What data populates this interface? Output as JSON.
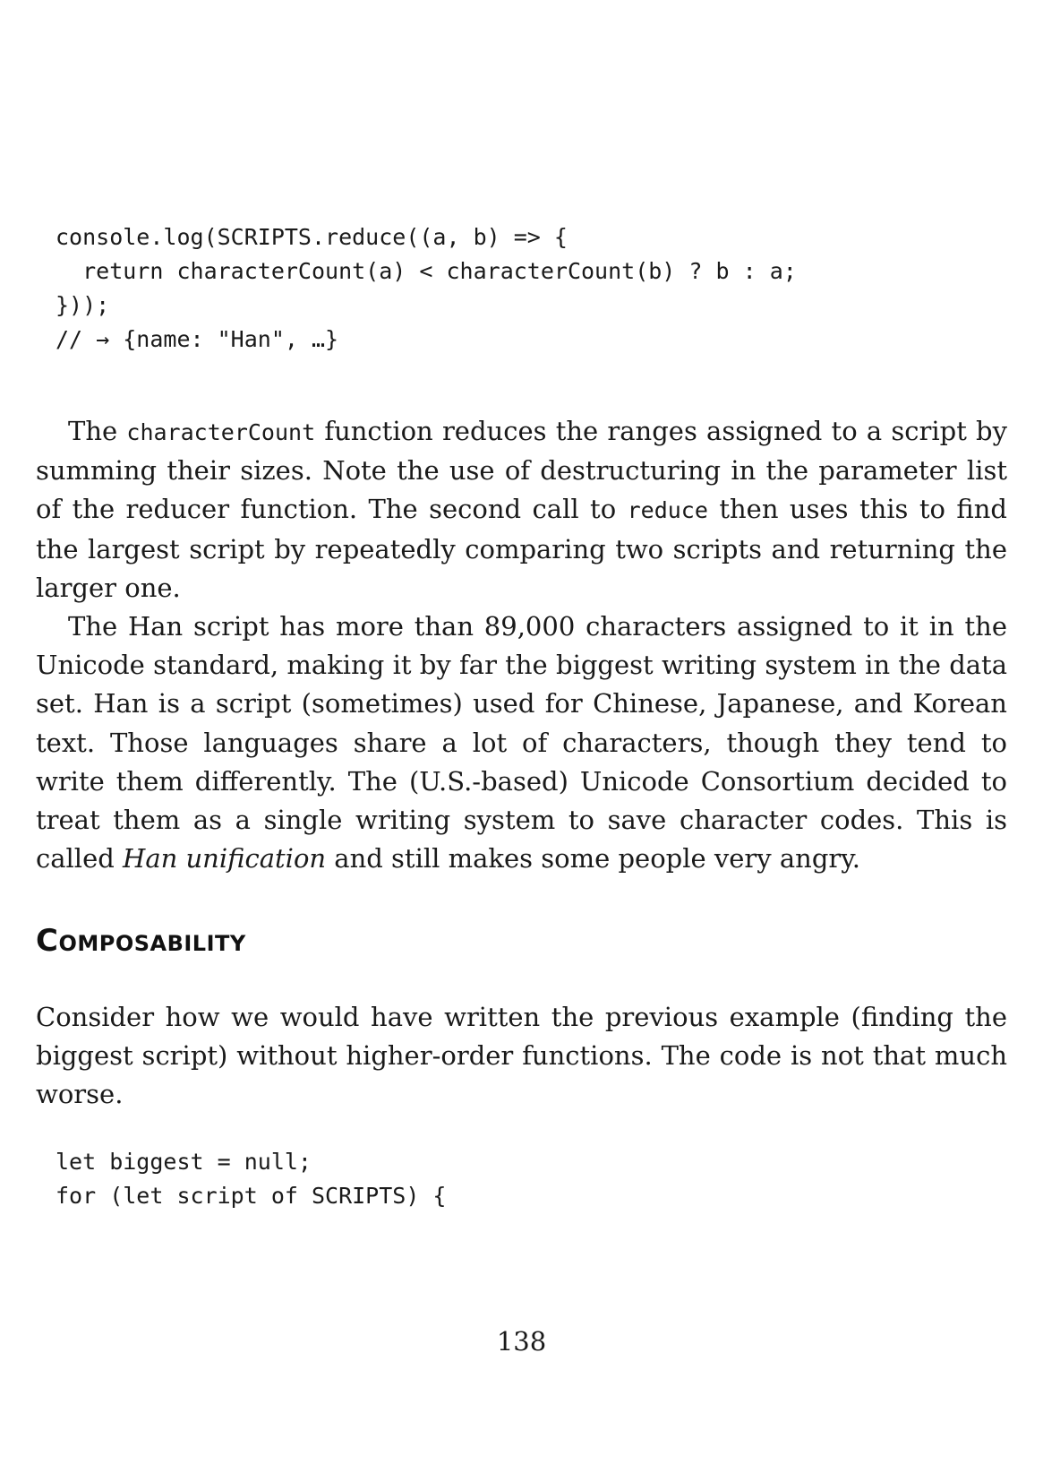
{
  "code_block_1": [
    "console.log(SCRIPTS.reduce((a, b) => {",
    "  return characterCount(a) < characterCount(b) ? b : a;",
    "}));",
    "// → {name: \"Han\", …}"
  ],
  "paragraph_1": {
    "t1": "The ",
    "c1": "characterCount",
    "t2": " function reduces the ranges assigned to a script by summing their sizes. Note the use of destructuring in the parameter list of the reducer function. The second call to ",
    "c2": "reduce",
    "t3": " then uses this to find the largest script by repeatedly comparing two scripts and returning the larger one."
  },
  "paragraph_2": {
    "t1": "The Han script has more than 89,000 characters assigned to it in the Unicode standard, making it by far the biggest writing system in the data set. Han is a script (sometimes) used for Chinese, Japanese, and Korean text. Those languages share a lot of characters, though they tend to write them differently. The (U.S.-based) Unicode Consortium decided to treat them as a single writing system to save character codes. This is called ",
    "em": "Han unification",
    "t2": " and still makes some people very angry."
  },
  "section_heading": "Composability",
  "paragraph_3": "Consider how we would have written the previous example (finding the biggest script) without higher-order functions. The code is not that much worse.",
  "code_block_2": [
    "let biggest = null;",
    "for (let script of SCRIPTS) {"
  ],
  "page_number": "138"
}
